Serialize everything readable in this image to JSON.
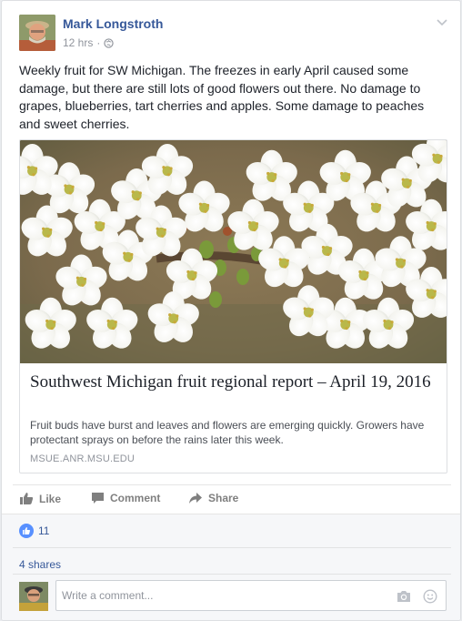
{
  "post": {
    "author": "Mark Longstroth",
    "time": "12 hrs",
    "meta_separator": "·",
    "text": "Weekly fruit for SW Michigan. The freezes in early April caused some damage, but there are still lots of good flowers out there. No damage to grapes, blueberries, tart cherries and apples. Some damage to peaches and sweet cherries."
  },
  "link": {
    "title": "Southwest Michigan fruit regional report – April 19, 2016",
    "description": "Fruit buds have burst and leaves and flowers are emerging quickly. Growers have protectant sprays on before the rains later this week.",
    "domain": "MSUE.ANR.MSU.EDU"
  },
  "actions": {
    "like": "Like",
    "comment": "Comment",
    "share": "Share"
  },
  "feedback": {
    "like_count": "11",
    "shares": "4 shares"
  },
  "comment_box": {
    "placeholder": "Write a comment..."
  },
  "colors": {
    "link_blue": "#365899",
    "like_blue": "#5890ff",
    "muted": "#90949c"
  },
  "icons": [
    "globe-icon",
    "chevron-down-icon",
    "like-icon",
    "comment-icon",
    "share-icon",
    "camera-icon",
    "smiley-icon"
  ]
}
